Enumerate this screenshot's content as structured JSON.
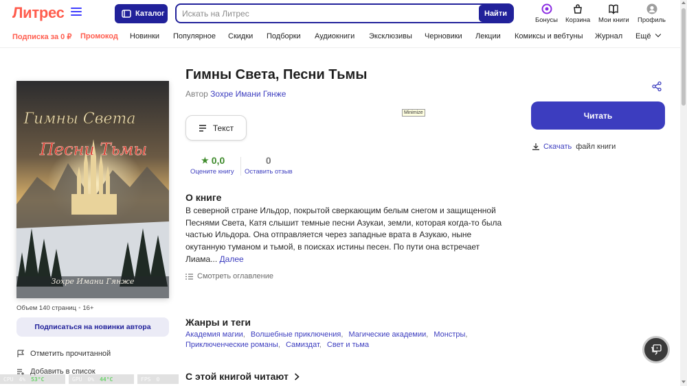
{
  "header": {
    "logo": "Литрес",
    "catalog_label": "Каталог",
    "search_placeholder": "Искать на Литрес",
    "search_button": "Найти",
    "icons": [
      {
        "label": "Бонусы",
        "icon": "bonus-icon"
      },
      {
        "label": "Корзина",
        "icon": "cart-icon"
      },
      {
        "label": "Мои книги",
        "icon": "book-icon"
      },
      {
        "label": "Профиль",
        "icon": "profile-icon"
      }
    ]
  },
  "nav": {
    "items": [
      "Подписка за 0 ₽",
      "Промокод",
      "Новинки",
      "Популярное",
      "Скидки",
      "Подборки",
      "Аудиокниги",
      "Эксклюзивы",
      "Черновики",
      "Лекции",
      "Комиксы и вебтуны",
      "Журнал",
      "Ещё"
    ]
  },
  "book": {
    "title": "Гимны Света, Песни Тьмы",
    "author_prefix": "Автор",
    "author": "Зохре Имани Гянже",
    "cover_line1": "Гимны Света",
    "cover_line2": "Песни Тьмы",
    "cover_author": "Зохре Имани Гянже",
    "pages": "Объем 140 страниц",
    "age": "16+",
    "format": "Текст",
    "rating_value": "0,0",
    "rating_caption": "Оцените книгу",
    "reviews_value": "0",
    "reviews_caption": "Оставить отзыв"
  },
  "left_actions": {
    "subscribe": "Подписаться на новинки автора",
    "mark_read": "Отметить прочитанной",
    "add_list": "Добавить в список"
  },
  "about": {
    "heading": "О книге",
    "text": "В северной стране Ильдор, покрытой сверкающим белым снегом и защищенной Песнями Света, Катя слышит темные песни Азукаи, земли, которая когда-то была частью Ильдора. Она отправляется через западные врата в Азукаю, ныне окутанную туманом и тьмой, в поисках истины песен. По пути она встречает Лиама...",
    "more": "Далее",
    "toc": "Смотреть оглавление"
  },
  "genres": {
    "heading": "Жанры и теги",
    "tags": [
      "Академия магии",
      "Волшебные приключения",
      "Магические академии",
      "Монстры",
      "Приключенческие романы",
      "Самиздат",
      "Свет и тьма"
    ]
  },
  "readers_heading": "С этой книгой читают",
  "right": {
    "read_button": "Читать",
    "download_link": "Скачать",
    "download_suffix": "файл книги",
    "tooltip": "Minimize"
  },
  "hwmon": {
    "cpu_label": "CPU",
    "cpu_load": "4%",
    "cpu_temp": "53°C",
    "gpu_label": "GPU",
    "gpu_load": "0%",
    "gpu_temp": "44°C",
    "fps_label": "FPS",
    "fps_value": "0"
  },
  "colors": {
    "brand": "#ff5c4d",
    "primary": "#3c3dbf",
    "dark_primary": "#21219a",
    "rating": "#3f8b2c"
  }
}
